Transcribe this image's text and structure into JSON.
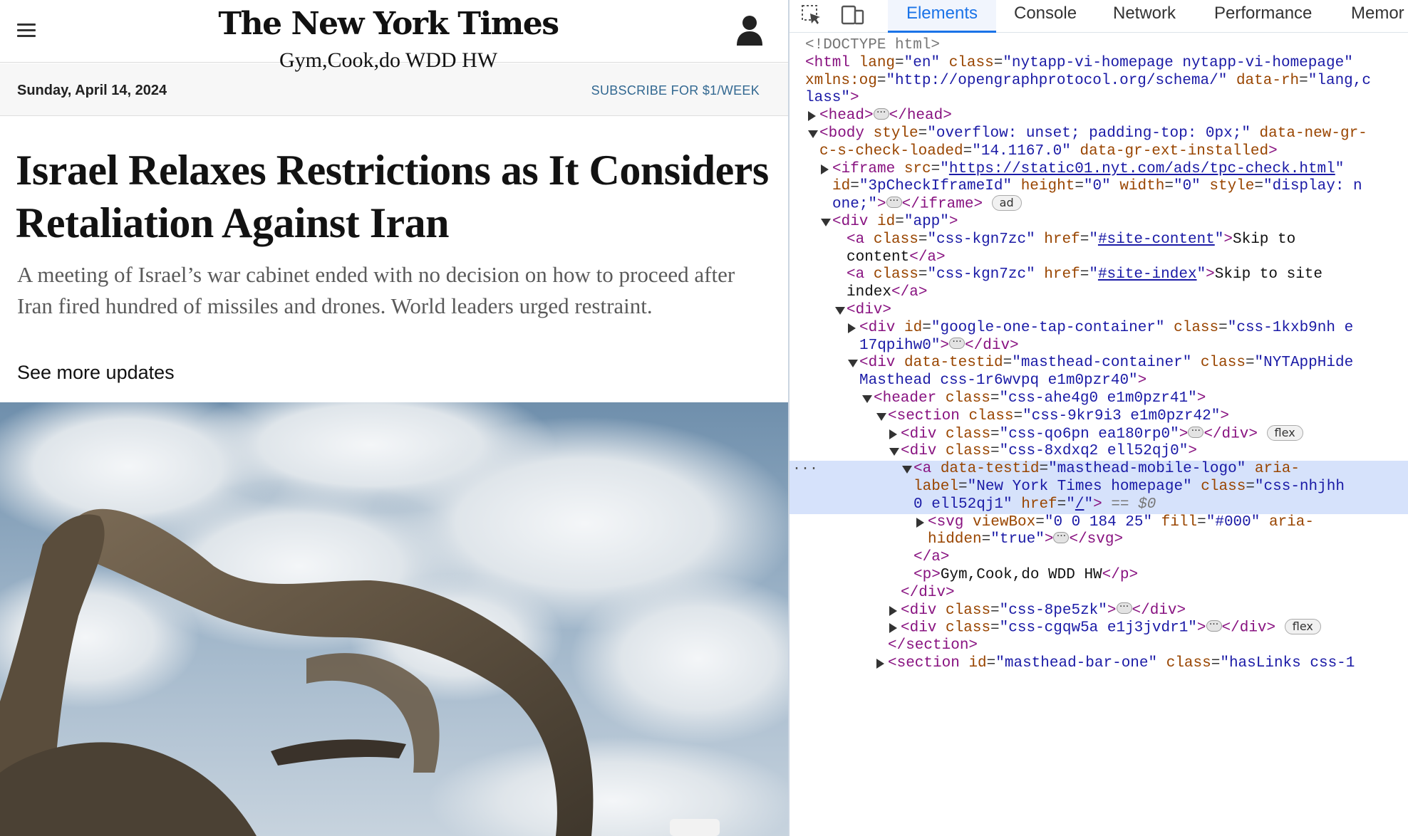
{
  "site": {
    "logo": "The New York Times",
    "masthead_text": "Gym,Cook,do WDD HW",
    "date": "Sunday, April 14, 2024",
    "subscribe": "SUBSCRIBE FOR $1/WEEK",
    "headline": "Israel Relaxes Restrictions as It Considers Retaliation Against Iran",
    "summary": "A meeting of Israel’s war cabinet ended with no decision on how to proceed after Iran fired hundred of missiles and drones. World leaders urged restraint.",
    "more_updates": "See more updates",
    "icons": {
      "menu": "hamburger-menu-icon",
      "account": "account-icon"
    }
  },
  "devtools": {
    "tabs": [
      "Elements",
      "Console",
      "Network",
      "Performance",
      "Memor"
    ],
    "active_tab": "Elements",
    "selection_marker": "== $0",
    "lines": [
      {
        "arrow": "none",
        "html": "<span class='gr'>&lt;!DOCTYPE html&gt;</span>"
      },
      {
        "arrow": "none",
        "html": "<span class='t'>&lt;html</span> <span class='an'>lang</span>=<span class='av'>\"en\"</span> <span class='an'>class</span>=<span class='av'>\"nytapp-vi-homepage nytapp-vi-homepage\"</span>"
      },
      {
        "arrow": "none",
        "html": "<span class='an'>xmlns:og</span>=<span class='av'>\"http://opengraphprotocol.org/schema/\"</span> <span class='an'>data-rh</span>=<span class='av'>\"lang,c</span>"
      },
      {
        "arrow": "none",
        "html": "<span class='av'>lass\"</span><span class='t'>&gt;</span>"
      },
      {
        "arrow": "right",
        "html": "<span class='t'>&lt;head&gt;</span><span class='ell'>···</span><span class='t'>&lt;/head&gt;</span>"
      },
      {
        "arrow": "down",
        "html": "<span class='t'>&lt;body</span> <span class='an'>style</span>=<span class='av'>\"overflow: unset; padding-top: 0px;\"</span> <span class='an'>data-new-gr-</span>"
      },
      {
        "arrow": "none",
        "html": "<span class='an'>c-s-check-loaded</span>=<span class='av'>\"14.1167.0\"</span> <span class='an'>data-gr-ext-installed</span><span class='t'>&gt;</span>"
      },
      {
        "arrow": "right",
        "html": "<span class='t'>&lt;iframe</span> <span class='an'>src</span>=<span class='av'>\"</span><span class='av-link'>https://static01.nyt.com/ads/tpc-check.html</span><span class='av'>\"</span>"
      },
      {
        "arrow": "none",
        "html": "<span class='an'>id</span>=<span class='av'>\"3pCheckIframeId\"</span> <span class='an'>height</span>=<span class='av'>\"0\"</span> <span class='an'>width</span>=<span class='av'>\"0\"</span> <span class='an'>style</span>=<span class='av'>\"display: n</span>"
      },
      {
        "arrow": "none",
        "html": "<span class='av'>one;\"</span><span class='t'>&gt;</span><span class='ell'>···</span><span class='t'>&lt;/iframe&gt;</span> <span class='pill'>ad</span>"
      },
      {
        "arrow": "down",
        "html": "<span class='t'>&lt;div</span> <span class='an'>id</span>=<span class='av'>\"app\"</span><span class='t'>&gt;</span>"
      },
      {
        "arrow": "none",
        "html": "<span class='t'>&lt;a</span> <span class='an'>class</span>=<span class='av'>\"css-kgn7zc\"</span> <span class='an'>href</span>=<span class='av'>\"</span><span class='av-link'>#site-content</span><span class='av'>\"</span><span class='t'>&gt;</span><span class='tx'>Skip to</span>"
      },
      {
        "arrow": "none",
        "html": "<span class='tx'>content</span><span class='t'>&lt;/a&gt;</span>"
      },
      {
        "arrow": "none",
        "html": "<span class='t'>&lt;a</span> <span class='an'>class</span>=<span class='av'>\"css-kgn7zc\"</span> <span class='an'>href</span>=<span class='av'>\"</span><span class='av-link'>#site-index</span><span class='av'>\"</span><span class='t'>&gt;</span><span class='tx'>Skip to site</span>"
      },
      {
        "arrow": "none",
        "html": "<span class='tx'>index</span><span class='t'>&lt;/a&gt;</span>"
      },
      {
        "arrow": "down",
        "html": "<span class='t'>&lt;div&gt;</span>"
      },
      {
        "arrow": "right",
        "html": "<span class='t'>&lt;div</span> <span class='an'>id</span>=<span class='av'>\"google-one-tap-container\"</span> <span class='an'>class</span>=<span class='av'>\"css-1kxb9nh e</span>"
      },
      {
        "arrow": "none",
        "html": "<span class='av'>17qpihw0\"</span><span class='t'>&gt;</span><span class='ell'>···</span><span class='t'>&lt;/div&gt;</span>"
      },
      {
        "arrow": "down",
        "html": "<span class='t'>&lt;div</span> <span class='an'>data-testid</span>=<span class='av'>\"masthead-container\"</span> <span class='an'>class</span>=<span class='av'>\"NYTAppHide</span>"
      },
      {
        "arrow": "none",
        "html": "<span class='av'>Masthead css-1r6wvpq e1m0pzr40\"</span><span class='t'>&gt;</span>"
      },
      {
        "arrow": "down",
        "html": "<span class='t'>&lt;header</span> <span class='an'>class</span>=<span class='av'>\"css-ahe4g0 e1m0pzr41\"</span><span class='t'>&gt;</span>"
      },
      {
        "arrow": "down",
        "html": "<span class='t'>&lt;section</span> <span class='an'>class</span>=<span class='av'>\"css-9kr9i3 e1m0pzr42\"</span><span class='t'>&gt;</span>"
      },
      {
        "arrow": "right",
        "html": "<span class='t'>&lt;div</span> <span class='an'>class</span>=<span class='av'>\"css-qo6pn ea180rp0\"</span><span class='t'>&gt;</span><span class='ell'>···</span><span class='t'>&lt;/div&gt;</span> <span class='pill'>flex</span>"
      },
      {
        "arrow": "down",
        "html": "<span class='t'>&lt;div</span> <span class='an'>class</span>=<span class='av'>\"css-8xdxq2 ell52qj0\"</span><span class='t'>&gt;</span>"
      },
      {
        "arrow": "down",
        "sel": true,
        "dots": "···",
        "html": "<span class='t'>&lt;a</span> <span class='an'>data-testid</span>=<span class='av'>\"masthead-mobile-logo\"</span> <span class='an'>aria-</span>"
      },
      {
        "arrow": "none",
        "sel": true,
        "html": "<span class='an'>label</span>=<span class='av'>\"New York Times homepage\"</span> <span class='an'>class</span>=<span class='av'>\"css-nhjhh</span>"
      },
      {
        "arrow": "none",
        "sel": true,
        "html": "<span class='av'>0 ell52qj1\"</span> <span class='an'>href</span>=<span class='av'>\"</span><span class='av-link'>/</span><span class='av'>\"</span><span class='t'>&gt;</span> <span class='gr'>== <i>$0</i></span>"
      },
      {
        "arrow": "right",
        "html": "<span class='t'>&lt;svg</span> <span class='an'>viewBox</span>=<span class='av'>\"0 0 184 25\"</span> <span class='an'>fill</span>=<span class='av'>\"#000\"</span> <span class='an'>aria-</span>"
      },
      {
        "arrow": "none",
        "html": "<span class='an'>hidden</span>=<span class='av'>\"true\"</span><span class='t'>&gt;</span><span class='ell'>···</span><span class='t'>&lt;/svg&gt;</span>"
      },
      {
        "arrow": "none",
        "html": "<span class='t'>&lt;/a&gt;</span>"
      },
      {
        "arrow": "none",
        "html": "<span class='t'>&lt;p&gt;</span><span class='tx'>Gym,Cook,do WDD HW</span><span class='t'>&lt;/p&gt;</span>"
      },
      {
        "arrow": "none",
        "html": "<span class='t'>&lt;/div&gt;</span>"
      },
      {
        "arrow": "right",
        "html": "<span class='t'>&lt;div</span> <span class='an'>class</span>=<span class='av'>\"css-8pe5zk\"</span><span class='t'>&gt;</span><span class='ell'>···</span><span class='t'>&lt;/div&gt;</span>"
      },
      {
        "arrow": "right",
        "html": "<span class='t'>&lt;div</span> <span class='an'>class</span>=<span class='av'>\"css-cgqw5a e1j3jvdr1\"</span><span class='t'>&gt;</span><span class='ell'>···</span><span class='t'>&lt;/div&gt;</span> <span class='pill'>flex</span>"
      },
      {
        "arrow": "none",
        "html": "<span class='t'>&lt;/section&gt;</span>"
      },
      {
        "arrow": "right",
        "html": "<span class='t'>&lt;section</span> <span class='an'>id</span>=<span class='av'>\"masthead-bar-one\"</span> <span class='an'>class</span>=<span class='av'>\"hasLinks css-1</span>"
      }
    ]
  }
}
